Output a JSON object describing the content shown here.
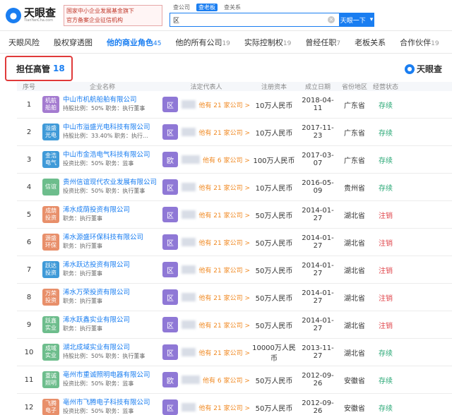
{
  "logo": {
    "text": "天眼查",
    "subtext": "TianYanCha.com"
  },
  "ad": {
    "line1": "国家中小企业发展基金旗下",
    "line2": "官方备案企业征信机构"
  },
  "search": {
    "tabs": [
      "查公司",
      "查老板",
      "查关系"
    ],
    "active_tab": 1,
    "value": "区",
    "button_label": "天眼一下"
  },
  "nav_tabs": [
    {
      "label": "天眼风险",
      "count": ""
    },
    {
      "label": "股权穿透图",
      "count": ""
    },
    {
      "label": "他的商业角色",
      "count": "45"
    },
    {
      "label": "他的所有公司",
      "count": "19"
    },
    {
      "label": "实际控制权",
      "count": "19"
    },
    {
      "label": "曾经任职",
      "count": "7"
    },
    {
      "label": "老板关系",
      "count": ""
    },
    {
      "label": "合作伙伴",
      "count": "19"
    }
  ],
  "section": {
    "title": "担任高管",
    "count": "18",
    "brand": "天眼查"
  },
  "table": {
    "headers": [
      "序号",
      "企业名称",
      "法定代表人",
      "注册资本",
      "成立日期",
      "省份地区",
      "经营状态"
    ],
    "rows": [
      {
        "idx": "1",
        "logo": "机航船舶",
        "logo_color": "#a47bd0",
        "name": "中山市机航船舶有限公司",
        "sub": "持股比例：50%   职务：执行董事",
        "avatar": "区",
        "avatar_color": "#8f78d6",
        "rep_link": "他有 21 家公司 >",
        "capital": "10万人民币",
        "date": "2018-04-11",
        "province": "广东省",
        "status": "存续",
        "status_type": "ok"
      },
      {
        "idx": "2",
        "logo": "溢盛光电",
        "logo_color": "#3f9ad8",
        "name": "中山市溢盛光电科技有限公司",
        "sub": "持股比例：33.40%   职务：执行...",
        "avatar": "区",
        "avatar_color": "#8f78d6",
        "rep_link": "他有 21 家公司 >",
        "capital": "10万人民币",
        "date": "2017-11-23",
        "province": "广东省",
        "status": "存续",
        "status_type": "ok"
      },
      {
        "idx": "3",
        "logo": "金浩电气",
        "logo_color": "#3f9ad8",
        "name": "中山市金浩电气科技有限公司",
        "sub": "投资比例：50%   职务：监事",
        "avatar": "欧",
        "avatar_color": "#8f78d6",
        "rep_link": "他有 6 家公司 >",
        "capital": "100万人民币",
        "date": "2017-03-07",
        "province": "广东省",
        "status": "存续",
        "status_type": "ok"
      },
      {
        "idx": "4",
        "logo": "信谊",
        "logo_color": "#6dbd8c",
        "name": "贵州信谊现代农业发展有限公司",
        "sub": "投资比例：50%   职务：执行董事",
        "avatar": "区",
        "avatar_color": "#8f78d6",
        "rep_link": "他有 21 家公司 >",
        "capital": "10万人民币",
        "date": "2016-05-09",
        "province": "贵州省",
        "status": "存续",
        "status_type": "ok"
      },
      {
        "idx": "5",
        "logo": "成荫投资",
        "logo_color": "#e88f6a",
        "name": "浠水成荫投资有限公司",
        "sub": "职务：执行董事",
        "avatar": "区",
        "avatar_color": "#8f78d6",
        "rep_link": "他有 21 家公司 >",
        "capital": "50万人民币",
        "date": "2014-01-27",
        "province": "湖北省",
        "status": "注销",
        "status_type": "off"
      },
      {
        "idx": "6",
        "logo": "源盛环保",
        "logo_color": "#e88f6a",
        "name": "浠水源盛环保科技有限公司",
        "sub": "职务：执行董事",
        "avatar": "区",
        "avatar_color": "#8f78d6",
        "rep_link": "他有 21 家公司 >",
        "capital": "50万人民币",
        "date": "2014-01-27",
        "province": "湖北省",
        "status": "注销",
        "status_type": "off"
      },
      {
        "idx": "7",
        "logo": "跃达投资",
        "logo_color": "#3f9ad8",
        "name": "浠水跃达投资有限公司",
        "sub": "职务：执行董事",
        "avatar": "区",
        "avatar_color": "#8f78d6",
        "rep_link": "他有 21 家公司 >",
        "capital": "50万人民币",
        "date": "2014-01-27",
        "province": "湖北省",
        "status": "注销",
        "status_type": "off"
      },
      {
        "idx": "8",
        "logo": "万荣投资",
        "logo_color": "#e88f6a",
        "name": "浠水万荣投资有限公司",
        "sub": "职务：执行董事",
        "avatar": "区",
        "avatar_color": "#8f78d6",
        "rep_link": "他有 21 家公司 >",
        "capital": "50万人民币",
        "date": "2014-01-27",
        "province": "湖北省",
        "status": "注销",
        "status_type": "off"
      },
      {
        "idx": "9",
        "logo": "跃鑫实业",
        "logo_color": "#6dbd8c",
        "name": "浠水跃鑫实业有限公司",
        "sub": "职务：执行董事",
        "avatar": "区",
        "avatar_color": "#8f78d6",
        "rep_link": "他有 21 家公司 >",
        "capital": "50万人民币",
        "date": "2014-01-27",
        "province": "湖北省",
        "status": "注销",
        "status_type": "off"
      },
      {
        "idx": "10",
        "logo": "成域实业",
        "logo_color": "#6dbd8c",
        "name": "湖北成域实业有限公司",
        "sub": "持股比例：50%   职务：执行董事",
        "avatar": "区",
        "avatar_color": "#8f78d6",
        "rep_link": "他有 21 家公司 >",
        "capital": "10000万人民币",
        "date": "2013-11-27",
        "province": "湖北省",
        "status": "存续",
        "status_type": "ok"
      },
      {
        "idx": "11",
        "logo": "重诚照明",
        "logo_color": "#6dbd8c",
        "name": "亳州市重诚照明电器有限公司",
        "sub": "投资比例：50%   职务：监事",
        "avatar": "欧",
        "avatar_color": "#8f78d6",
        "rep_link": "他有 6 家公司 >",
        "capital": "50万人民币",
        "date": "2012-09-26",
        "province": "安徽省",
        "status": "存续",
        "status_type": "ok"
      },
      {
        "idx": "12",
        "logo": "飞腾电子",
        "logo_color": "#e88f6a",
        "name": "亳州市飞腾电子科技有限公司",
        "sub": "投资比例：50%   职务：监事",
        "avatar": "区",
        "avatar_color": "#8f78d6",
        "rep_link": "他有 21 家公司 >",
        "capital": "50万人民币",
        "date": "2012-09-26",
        "province": "安徽省",
        "status": "存续",
        "status_type": "ok"
      }
    ]
  }
}
